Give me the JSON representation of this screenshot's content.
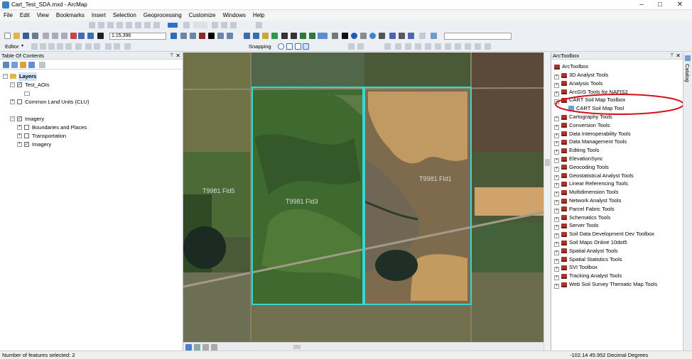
{
  "window": {
    "title": "Cart_Test_SDA.mxd - ArcMap"
  },
  "menu": [
    "File",
    "Edit",
    "View",
    "Bookmarks",
    "Insert",
    "Selection",
    "Geoprocessing",
    "Customize",
    "Windows",
    "Help"
  ],
  "toolbar": {
    "scale": "1:15,396",
    "editor_label": "Editor",
    "snapping_label": "Snapping"
  },
  "toc": {
    "title": "Table Of Contents",
    "layers_root": "Layers",
    "items": [
      {
        "label": "Test_AOIs",
        "checked": true
      },
      {
        "label": "Common Land Units (CLU)",
        "checked": false
      },
      {
        "label": "Imagery",
        "checked": true
      },
      {
        "label": "Boundaries and Places",
        "checked": false
      },
      {
        "label": "Transportation",
        "checked": false
      },
      {
        "label": "Imagery",
        "checked": true
      }
    ]
  },
  "map": {
    "labels": [
      "T9981 Fld5",
      "T9981 Fld3",
      "T9981 Fld1"
    ],
    "boundary_color": "#34d7d2"
  },
  "toolbox": {
    "title": "ArcToolbox",
    "root": "ArcToolbox",
    "items": [
      "3D Analyst Tools",
      "Analysis Tools",
      "ArcGIS Tools for NAFIS2",
      "CART Soil Map Toolbox",
      "CART Soil Map Tool",
      "Cartography Tools",
      "Conversion Tools",
      "Data Interoperability Tools",
      "Data Management Tools",
      "Editing Tools",
      "ElevationSync",
      "Geocoding Tools",
      "Geostatistical Analyst Tools",
      "Linear Referencing Tools",
      "Multidimension Tools",
      "Network Analyst Tools",
      "Parcel Fabric Tools",
      "Schematics Tools",
      "Server Tools",
      "Soil Data Development Dev Toolbox",
      "Soil Maps Online 10dot5",
      "Spatial Analyst Tools",
      "Spatial Statistics Tools",
      "SVI Toolbox",
      "Tracking Analyst Tools",
      "Web Soil Survey Thematic Map Tools"
    ],
    "highlight_color": "#d0131a"
  },
  "catalog_tab": "Catalog",
  "status": {
    "selected": "Number of features selected: 2",
    "coords": "-102.14  45.952 Decimal Degrees"
  }
}
